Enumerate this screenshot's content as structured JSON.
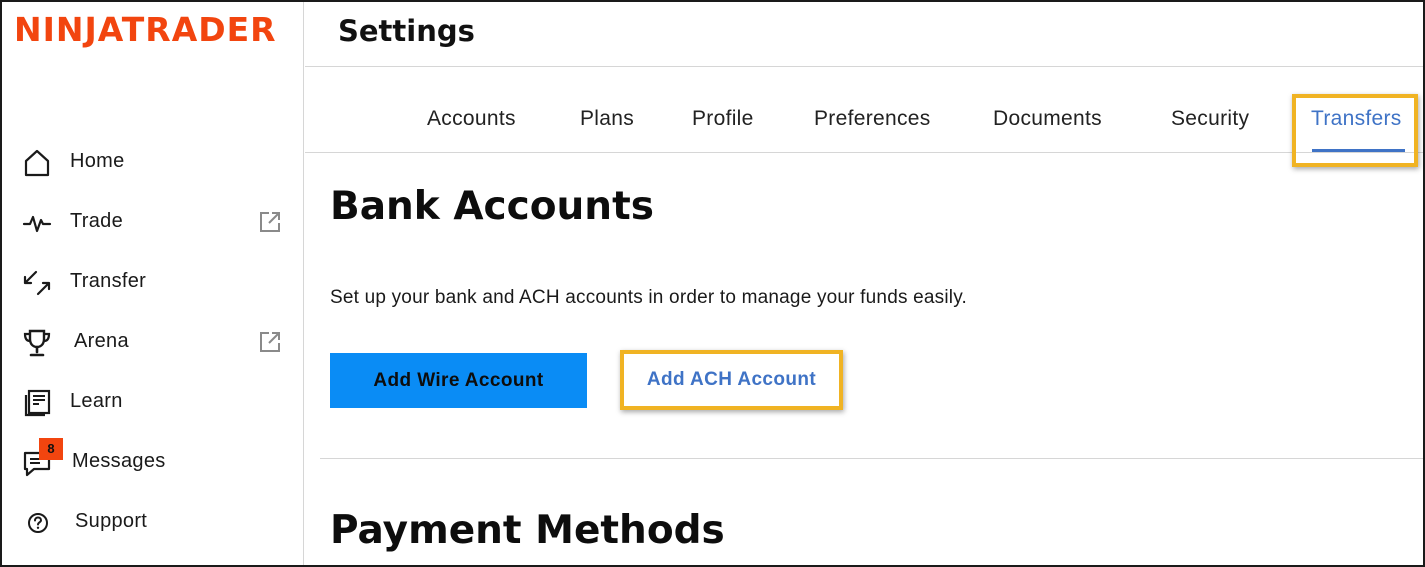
{
  "brand": {
    "logo_text": "NINJATRADER",
    "accent_color": "#f2450f",
    "link_color": "#3f73c6",
    "primary_button_color": "#0a8cf5",
    "highlight_color": "#f0b323"
  },
  "sidebar": {
    "items": [
      {
        "label": "Home",
        "icon": "home-icon"
      },
      {
        "label": "Trade",
        "icon": "pulse-icon",
        "external": true
      },
      {
        "label": "Transfer",
        "icon": "transfer-arrows-icon"
      },
      {
        "label": "Arena",
        "icon": "trophy-icon",
        "external": true
      },
      {
        "label": "Learn",
        "icon": "book-icon"
      },
      {
        "label": "Messages",
        "icon": "chat-icon",
        "badge": "8"
      },
      {
        "label": "Support",
        "icon": "help-circle-icon"
      }
    ]
  },
  "header": {
    "title": "Settings"
  },
  "tabs": [
    {
      "label": "Accounts"
    },
    {
      "label": "Plans"
    },
    {
      "label": "Profile"
    },
    {
      "label": "Preferences"
    },
    {
      "label": "Documents"
    },
    {
      "label": "Security"
    },
    {
      "label": "Transfers",
      "active": true
    }
  ],
  "main": {
    "bank_accounts": {
      "title": "Bank Accounts",
      "description": "Set up your bank and ACH accounts in order to manage your funds easily.",
      "add_wire_label": "Add Wire Account",
      "add_ach_label": "Add ACH Account"
    },
    "payment_methods": {
      "title": "Payment Methods"
    }
  }
}
